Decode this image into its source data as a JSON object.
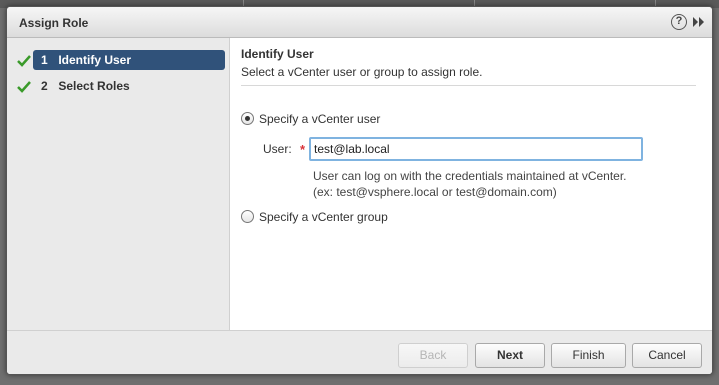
{
  "dialog": {
    "title": "Assign Role",
    "help_glyph": "?",
    "icons": {
      "help": "help-icon",
      "expand": "double-chevron-right-icon",
      "check": "checkmark-icon"
    }
  },
  "steps": [
    {
      "number": "1",
      "label": "Identify User",
      "active": true,
      "completed": true
    },
    {
      "number": "2",
      "label": "Select Roles",
      "active": false,
      "completed": true
    }
  ],
  "content": {
    "heading": "Identify User",
    "subheading": "Select a vCenter user or group to assign role.",
    "option_user": "Specify a vCenter user",
    "user_label": "User:",
    "required_marker": "*",
    "user_value": "test@lab.local",
    "hint_line1": "User can log on with the credentials maintained at vCenter.",
    "hint_line2": "(ex: test@vsphere.local or test@domain.com)",
    "option_group": "Specify a vCenter group",
    "selected_option": "user"
  },
  "footer": {
    "back": "Back",
    "next": "Next",
    "finish": "Finish",
    "cancel": "Cancel"
  },
  "colors": {
    "active_step": "#30527a",
    "check": "#3a9a2a",
    "required": "#d9343a",
    "input_focus": "#7fb3e0"
  }
}
